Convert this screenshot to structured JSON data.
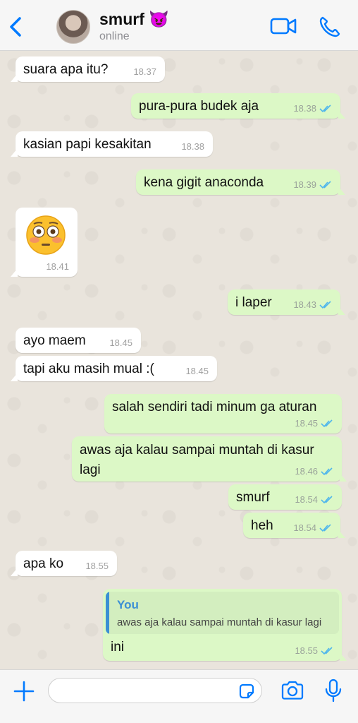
{
  "header": {
    "contact_name": "smurf",
    "contact_emoji": "😈",
    "status": "online",
    "icons": [
      "chevron-left-icon",
      "video-call-icon",
      "phone-icon"
    ]
  },
  "colors": {
    "accent": "#007aff",
    "outgoing_bubble": "#dcf8c6",
    "incoming_bubble": "#ffffff",
    "read_ticks": "#4fb6ec",
    "chat_background": "#e9e4dc"
  },
  "messages": [
    {
      "dir": "in",
      "text": "suara apa itu?",
      "time": "18.37"
    },
    {
      "dir": "out",
      "text": "pura-pura budek aja",
      "time": "18.38",
      "read": true
    },
    {
      "dir": "in",
      "text": "kasian papi kesakitan",
      "time": "18.38"
    },
    {
      "dir": "out",
      "text": "kena gigit anaconda",
      "time": "18.39",
      "read": true
    },
    {
      "dir": "in",
      "emoji": "😳",
      "time": "18.41"
    },
    {
      "dir": "out",
      "text": "i laper",
      "time": "18.43",
      "read": true
    },
    {
      "dir": "in",
      "text": "ayo maem",
      "time": "18.45"
    },
    {
      "dir": "in",
      "text": "tapi aku masih mual :(",
      "time": "18.45"
    },
    {
      "dir": "out",
      "text": "salah sendiri tadi minum ga aturan",
      "time": "18.45",
      "read": true
    },
    {
      "dir": "out",
      "text": "awas aja kalau sampai muntah di kasur lagi",
      "time": "18.46",
      "read": true
    },
    {
      "dir": "out",
      "text": "smurf",
      "time": "18.54",
      "read": true
    },
    {
      "dir": "out",
      "text": "heh",
      "time": "18.54",
      "read": true
    },
    {
      "dir": "in",
      "text": "apa ko",
      "time": "18.55"
    },
    {
      "dir": "out",
      "text": "ini",
      "time": "18.55",
      "read": true,
      "reply": {
        "author": "You",
        "text": "awas aja kalau sampai muntah di kasur lagi"
      }
    }
  ],
  "footer": {
    "icons": [
      "plus-icon",
      "sticker-icon",
      "camera-icon",
      "microphone-icon"
    ],
    "input_value": ""
  }
}
